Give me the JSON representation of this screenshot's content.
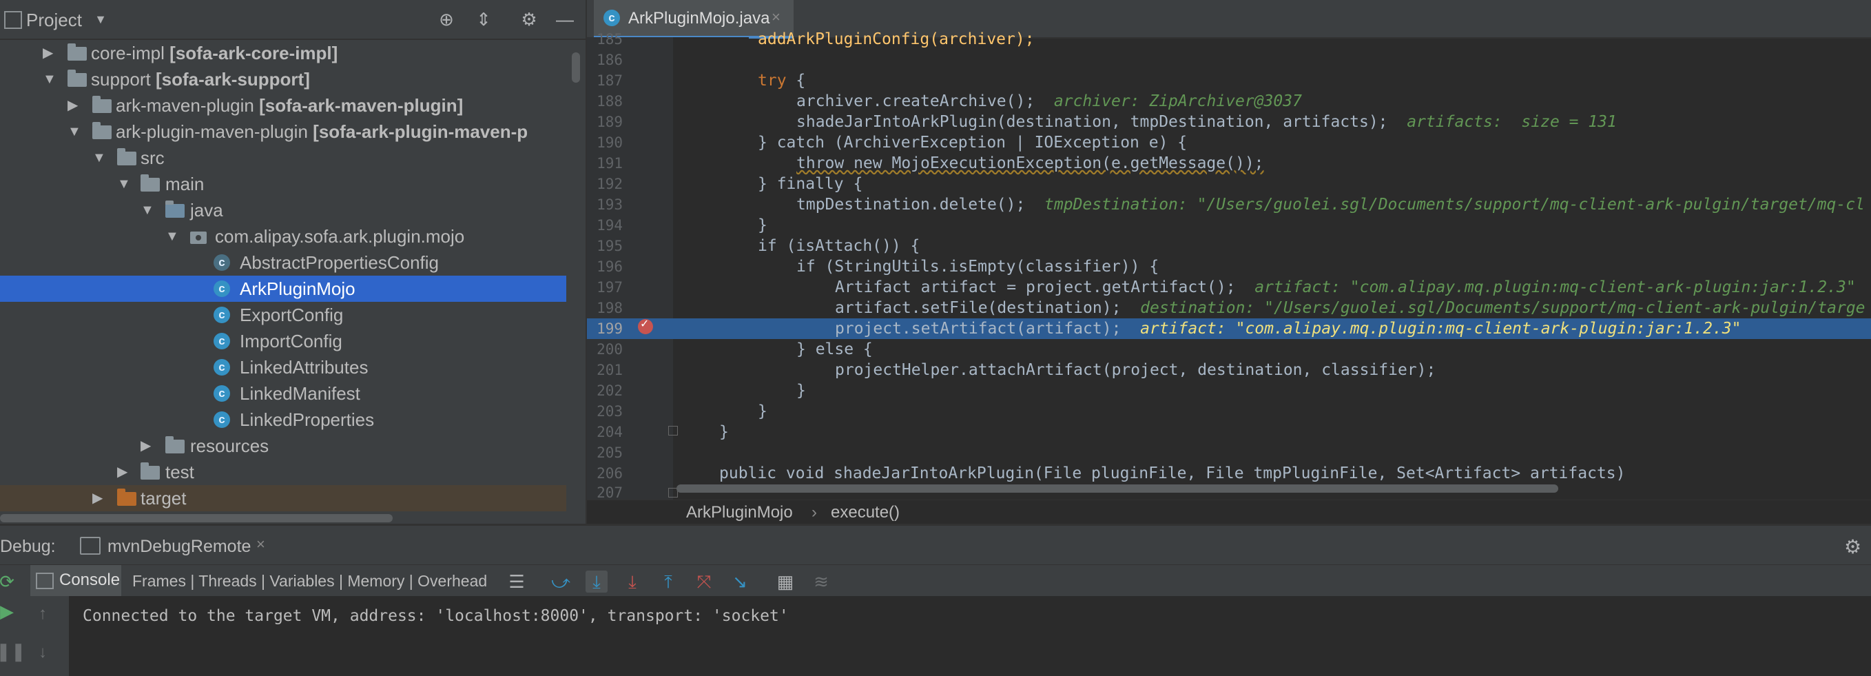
{
  "project": {
    "title": "Project",
    "tree": [
      {
        "label": "core-impl",
        "bold": "[sofa-ark-core-impl]"
      },
      {
        "label": "support",
        "bold": "[sofa-ark-support]"
      },
      {
        "label": "ark-maven-plugin",
        "bold": "[sofa-ark-maven-plugin]"
      },
      {
        "label": "ark-plugin-maven-plugin",
        "bold": "[sofa-ark-plugin-maven-p"
      },
      {
        "label": "src"
      },
      {
        "label": "main"
      },
      {
        "label": "java"
      },
      {
        "label": "com.alipay.sofa.ark.plugin.mojo"
      },
      {
        "label": "AbstractPropertiesConfig"
      },
      {
        "label": "ArkPluginMojo"
      },
      {
        "label": "ExportConfig"
      },
      {
        "label": "ImportConfig"
      },
      {
        "label": "LinkedAttributes"
      },
      {
        "label": "LinkedManifest"
      },
      {
        "label": "LinkedProperties"
      },
      {
        "label": "resources"
      },
      {
        "label": "test"
      },
      {
        "label": "target"
      }
    ]
  },
  "editor": {
    "tab_label": "ArkPluginMojo.java",
    "tab_close": "×",
    "class_glyph": "c",
    "lines": [
      {
        "n": "185",
        "t": ""
      },
      {
        "n": "186",
        "t": ""
      },
      {
        "n": "187",
        "t": "try"
      },
      {
        "n": "188",
        "t": "archiver.createArchive();"
      },
      {
        "n": "189",
        "t": "shadeJarIntoArkPlugin(destination, tmpDestination, artifacts);"
      },
      {
        "n": "190",
        "t": "} catch (ArchiverException | IOException e) {"
      },
      {
        "n": "191",
        "t": "throw new MojoExecutionException(e.getMessage());"
      },
      {
        "n": "192",
        "t": "} finally {"
      },
      {
        "n": "193",
        "t": "tmpDestination.delete();"
      },
      {
        "n": "194",
        "t": "}"
      },
      {
        "n": "195",
        "t": "if (isAttach()) {"
      },
      {
        "n": "196",
        "t": "if (StringUtils.isEmpty(classifier)) {"
      },
      {
        "n": "197",
        "t": "Artifact artifact = project.getArtifact();"
      },
      {
        "n": "198",
        "t": "artifact.setFile(destination);"
      },
      {
        "n": "199",
        "t": "project.setArtifact(artifact);"
      },
      {
        "n": "200",
        "t": "} else {"
      },
      {
        "n": "201",
        "t": "projectHelper.attachArtifact(project, destination, classifier);"
      },
      {
        "n": "202",
        "t": "}"
      },
      {
        "n": "203",
        "t": "}"
      },
      {
        "n": "204",
        "t": "}"
      },
      {
        "n": "205",
        "t": ""
      },
      {
        "n": "206",
        "t": "public void shadeJarIntoArkPlugin(File pluginFile, File tmpPluginFile, Set<Artifact> artifacts)"
      },
      {
        "n": "207",
        "t": ""
      }
    ],
    "top_line_text": "addArkPluginConfig(archiver);",
    "inline": {
      "l188": "archiver: ZipArchiver@3037",
      "l189": "artifacts:  size = 131",
      "l193": "tmpDestination: \"/Users/guolei.sgl/Documents/support/mq-client-ark-pulgin/target/mq-cl",
      "l197": "artifact: \"com.alipay.mq.plugin:mq-client-ark-plugin:jar:1.2.3\"",
      "l198": "destination: \"/Users/guolei.sgl/Documents/support/mq-client-ark-pulgin/targe",
      "l199": "artifact: \"com.alipay.mq.plugin:mq-client-ark-plugin:jar:1.2.3\""
    }
  },
  "breadcrumb": {
    "file": "ArkPluginMojo",
    "sep": "›",
    "method": "execute()"
  },
  "debug": {
    "label": "Debug:",
    "session": "mvnDebugRemote",
    "session_close": "×",
    "console_label": "Console",
    "tabs_text": "Frames | Threads | Variables | Memory | Overhead",
    "console_output": "Connected to the target VM, address: 'localhost:8000', transport: 'socket'"
  },
  "colors": {
    "accent": "#2f65ca",
    "current_line": "#2d5c93",
    "breakpoint": "#c75450"
  }
}
